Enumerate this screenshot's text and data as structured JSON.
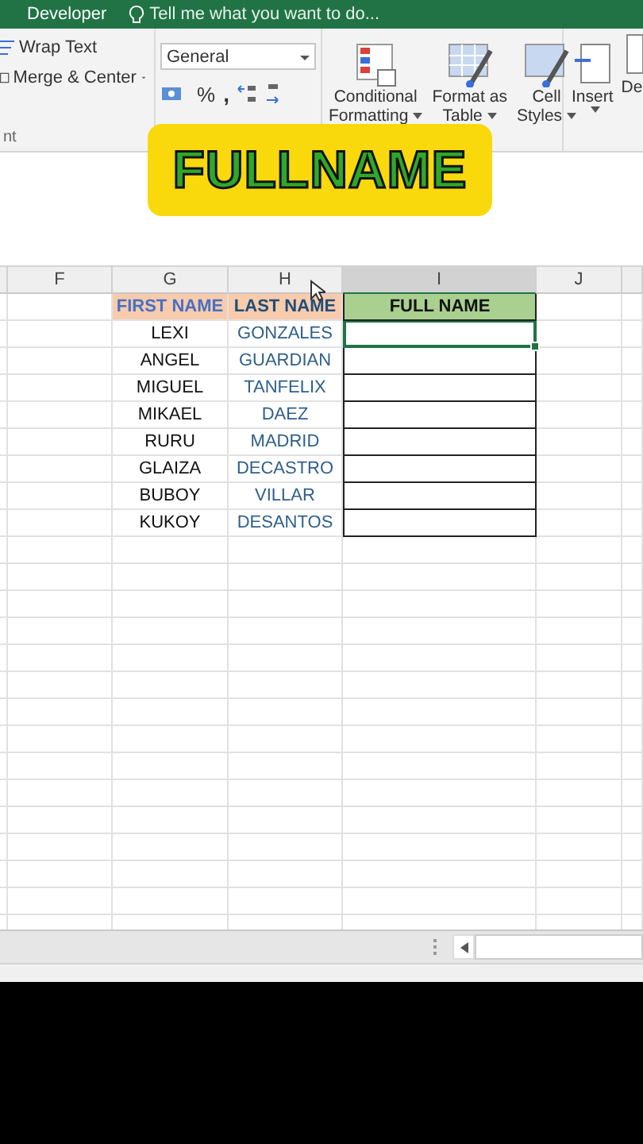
{
  "title_bar": {
    "tab": "Developer",
    "tell_me": "Tell me what you want to do..."
  },
  "ribbon": {
    "wrap_text": "Wrap Text",
    "merge_center": "Merge & Center",
    "alignment_group_label": "nt",
    "number_format": "General",
    "percent": "%",
    "comma": ",",
    "styles": [
      {
        "line1": "Conditional",
        "line2": "Formatting",
        "kind": "conditional"
      },
      {
        "line1": "Format as",
        "line2": "Table",
        "kind": "table"
      },
      {
        "line1": "Cell",
        "line2": "Styles",
        "kind": "cell"
      }
    ],
    "insert": "Insert",
    "delete_cut": "De"
  },
  "badge": "FULLNAME",
  "columns": [
    {
      "selected": false
    },
    {
      "label": "F",
      "selected": false
    },
    {
      "label": "G",
      "selected": false
    },
    {
      "label": "H",
      "selected": false
    },
    {
      "label": "I",
      "selected": true
    },
    {
      "label": "J",
      "selected": false
    },
    {
      "selected": false
    }
  ],
  "headers": {
    "first": "FIRST NAME",
    "last": "LAST NAME",
    "full": "FULL NAME"
  },
  "rows": [
    {
      "first": "LEXI",
      "last": "GONZALES",
      "selected": true
    },
    {
      "first": "ANGEL",
      "last": "GUARDIAN",
      "selected": false
    },
    {
      "first": "MIGUEL",
      "last": "TANFELIX",
      "selected": false
    },
    {
      "first": "MIKAEL",
      "last": "DAEZ",
      "selected": false
    },
    {
      "first": "RURU",
      "last": "MADRID",
      "selected": false
    },
    {
      "first": "GLAIZA",
      "last": "DECASTRO",
      "selected": false
    },
    {
      "first": "BUBOY",
      "last": "VILLAR",
      "selected": false
    },
    {
      "first": "KUKOY",
      "last": "DESANTOS",
      "selected": false
    }
  ]
}
